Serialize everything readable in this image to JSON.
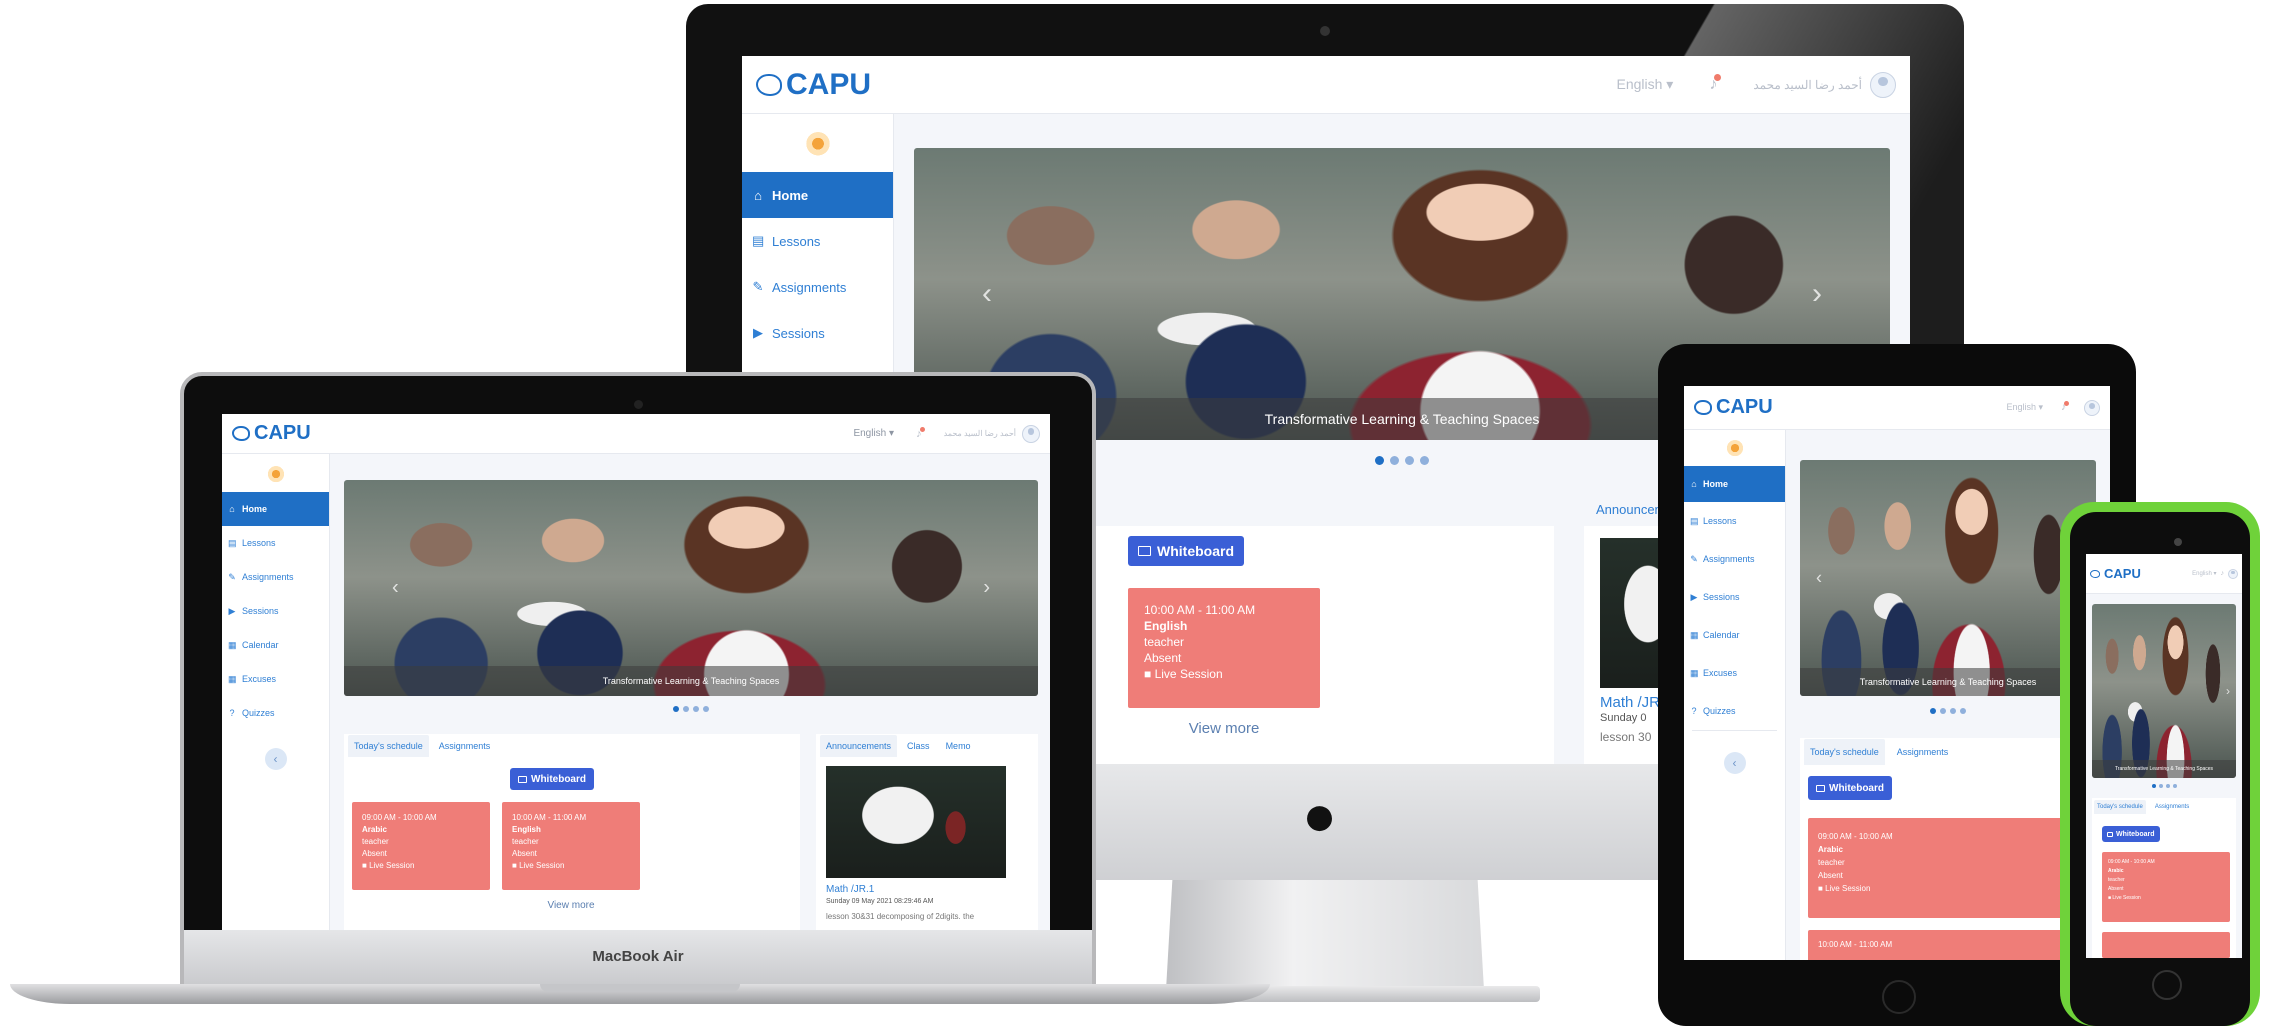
{
  "app": {
    "logo_text": "CAPU",
    "language": "English",
    "user_name": "أحمد رضا السيد محمد"
  },
  "nav": {
    "items": [
      {
        "label": "Home",
        "icon": "home-icon"
      },
      {
        "label": "Lessons",
        "icon": "book-icon"
      },
      {
        "label": "Assignments",
        "icon": "edit-icon"
      },
      {
        "label": "Sessions",
        "icon": "video-icon"
      },
      {
        "label": "Calendar",
        "icon": "calendar-icon"
      },
      {
        "label": "Excuses",
        "icon": "calendar-icon"
      },
      {
        "label": "Quizzes",
        "icon": "question-icon"
      }
    ],
    "collapse": "‹"
  },
  "hero": {
    "caption": "Transformative Learning & Teaching Spaces",
    "prev": "‹",
    "next": "›"
  },
  "schedule": {
    "tabs": [
      "Today's schedule",
      "Assignments"
    ],
    "whiteboard": "Whiteboard",
    "cards": [
      {
        "time": "09:00 AM - 10:00 AM",
        "subject": "Arabic",
        "role": "teacher",
        "status": "Absent",
        "link": "Live Session"
      },
      {
        "time": "10:00 AM - 11:00 AM",
        "subject": "English",
        "role": "teacher",
        "status": "Absent",
        "link": "Live Session"
      }
    ],
    "view_more": "View more",
    "partial_header": "ments"
  },
  "announcements": {
    "tabs": [
      "Announcements",
      "Class",
      "Memo"
    ],
    "partial_tab": "Announcem",
    "item": {
      "title": "Math /JR.1",
      "partial_title": "Math /JR",
      "date": "Sunday 09 May 2021 08:29:46 AM",
      "partial_date": "Sunday 0",
      "text": "lesson 30&31 decomposing of 2digits. the",
      "partial_text": "lesson 30"
    }
  },
  "devices": {
    "laptop_label": "MacBook Air"
  },
  "phone": {
    "tabs": [
      "Today's schedule",
      "Assignments"
    ],
    "card": {
      "time": "09:00 AM - 10:00 AM",
      "subject": "Arabic",
      "role": "teacher",
      "status": "Absent",
      "link": "Live Session"
    }
  },
  "colors": {
    "primary": "#1f6fc5",
    "card": "#ef7d78",
    "whiteboard": "#3a5fd6",
    "phone_shell": "#6fd23a"
  }
}
